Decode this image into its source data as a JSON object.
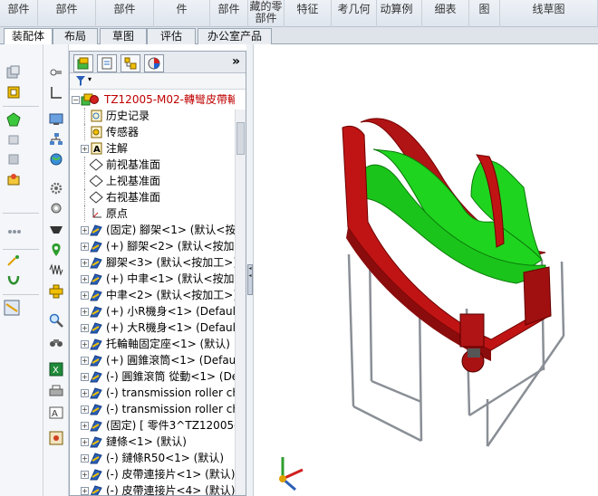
{
  "ribbon": [
    {
      "label": "部件",
      "label2": ""
    },
    {
      "label": "部件",
      "label2": ""
    },
    {
      "label": "部件",
      "label2": ""
    },
    {
      "label": "件",
      "label2": ""
    },
    {
      "label": "部件",
      "label2": ""
    },
    {
      "label": "藏的零",
      "label2": "部件"
    },
    {
      "label": "特征",
      "label2": ""
    },
    {
      "label": "考几何",
      "label2": ""
    },
    {
      "label": "动算例",
      "label2": ""
    },
    {
      "label": "细表",
      "label2": ""
    },
    {
      "label": "图",
      "label2": ""
    },
    {
      "label": "线草图",
      "label2": ""
    }
  ],
  "tabs": [
    "装配体",
    "布局",
    "草图",
    "评估",
    "办公室产品"
  ],
  "panel": {
    "expand_glyph": "»",
    "tabs": [
      "feature-manager",
      "property-manager",
      "configuration-manager",
      "display-manager"
    ]
  },
  "tree": [
    {
      "label": "TZ12005-M02-轉彎皮帶輸",
      "icon": "assembly-icon",
      "expand": "−",
      "indent": 0,
      "color": "#c00000"
    },
    {
      "label": "历史记录",
      "icon": "history-icon",
      "expand": "",
      "indent": 1
    },
    {
      "label": "传感器",
      "icon": "sensor-icon",
      "expand": "",
      "indent": 1
    },
    {
      "label": "注解",
      "icon": "annotation-icon",
      "expand": "+",
      "indent": 1
    },
    {
      "label": "前视基准面",
      "icon": "plane-icon",
      "expand": "",
      "indent": 1
    },
    {
      "label": "上视基准面",
      "icon": "plane-icon",
      "expand": "",
      "indent": 1
    },
    {
      "label": "右视基准面",
      "icon": "plane-icon",
      "expand": "",
      "indent": 1
    },
    {
      "label": "原点",
      "icon": "origin-icon",
      "expand": "",
      "indent": 1
    },
    {
      "label": "(固定) 腳架<1> (默认<按加",
      "icon": "part-icon",
      "expand": "+",
      "indent": 1
    },
    {
      "label": "(+) 腳架<2> (默认<按加工",
      "icon": "part-icon",
      "expand": "+",
      "indent": 1
    },
    {
      "label": "腳架<3> (默认<按加工>)",
      "icon": "part-icon",
      "expand": "+",
      "indent": 1
    },
    {
      "label": "(+) 中聿<1> (默认<按加工",
      "icon": "part-icon",
      "expand": "+",
      "indent": 1
    },
    {
      "label": "中聿<2> (默认<按加工>)",
      "icon": "part-icon",
      "expand": "+",
      "indent": 1
    },
    {
      "label": "(+) 小R機身<1> (Default",
      "icon": "part-icon",
      "expand": "+",
      "indent": 1
    },
    {
      "label": "(+) 大R機身<1> (Default",
      "icon": "part-icon",
      "expand": "+",
      "indent": 1
    },
    {
      "label": "托輪軸固定座<1> (默认)",
      "icon": "part-icon",
      "expand": "+",
      "indent": 1
    },
    {
      "label": "(+) 圓錐滾筒<1> (Default",
      "icon": "part-icon",
      "expand": "+",
      "indent": 1
    },
    {
      "label": "(-) 圓錐滾筒 從動<1> (De",
      "icon": "part-icon",
      "expand": "+",
      "indent": 1
    },
    {
      "label": "(-) transmission roller ch",
      "icon": "part-icon",
      "expand": "+",
      "indent": 1
    },
    {
      "label": "(-) transmission roller ch",
      "icon": "part-icon",
      "expand": "+",
      "indent": 1
    },
    {
      "label": "(固定) [ 零件3^TZ12005-M",
      "icon": "part-icon",
      "expand": "+",
      "indent": 1
    },
    {
      "label": "鏈條<1> (默认)",
      "icon": "part-icon",
      "expand": "+",
      "indent": 1
    },
    {
      "label": "(-) 鏈條R50<1> (默认)",
      "icon": "part-icon",
      "expand": "+",
      "indent": 1
    },
    {
      "label": "(-) 皮帶連接片<1> (默认)",
      "icon": "part-icon",
      "expand": "+",
      "indent": 1
    },
    {
      "label": "(-) 皮帶連接片<4> (默认)",
      "icon": "part-icon",
      "expand": "+",
      "indent": 1
    }
  ],
  "colors": {
    "belt_green": "#1fd41f",
    "frame_red": "#c01414",
    "accent_blue": "#2a5fb8"
  }
}
